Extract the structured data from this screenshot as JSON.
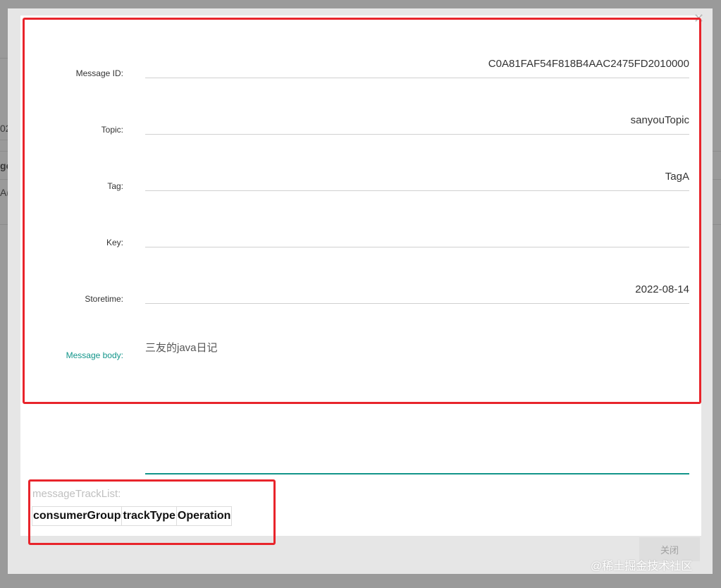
{
  "background": {
    "partial_texts": [
      "02",
      "ge",
      "A("
    ]
  },
  "dialog": {
    "close_icon": "close-icon",
    "fields": [
      {
        "label": "Message ID:",
        "value": "C0A81FAF54F818B4AAC2475FD2010000"
      },
      {
        "label": "Topic:",
        "value": "sanyouTopic"
      },
      {
        "label": "Tag:",
        "value": "TagA"
      },
      {
        "label": "Key:",
        "value": ""
      },
      {
        "label": "Storetime:",
        "value": "2022-08-14"
      }
    ],
    "message_body": {
      "label": "Message body:",
      "value": "三友的java日记"
    },
    "track": {
      "label": "messageTrackList:",
      "columns": [
        "consumerGroup",
        "trackType",
        "Operation"
      ]
    },
    "close_button": "关闭"
  },
  "watermark": "@稀土掘金技术社区",
  "colors": {
    "accent": "#12958a",
    "highlight": "#e8242b"
  }
}
